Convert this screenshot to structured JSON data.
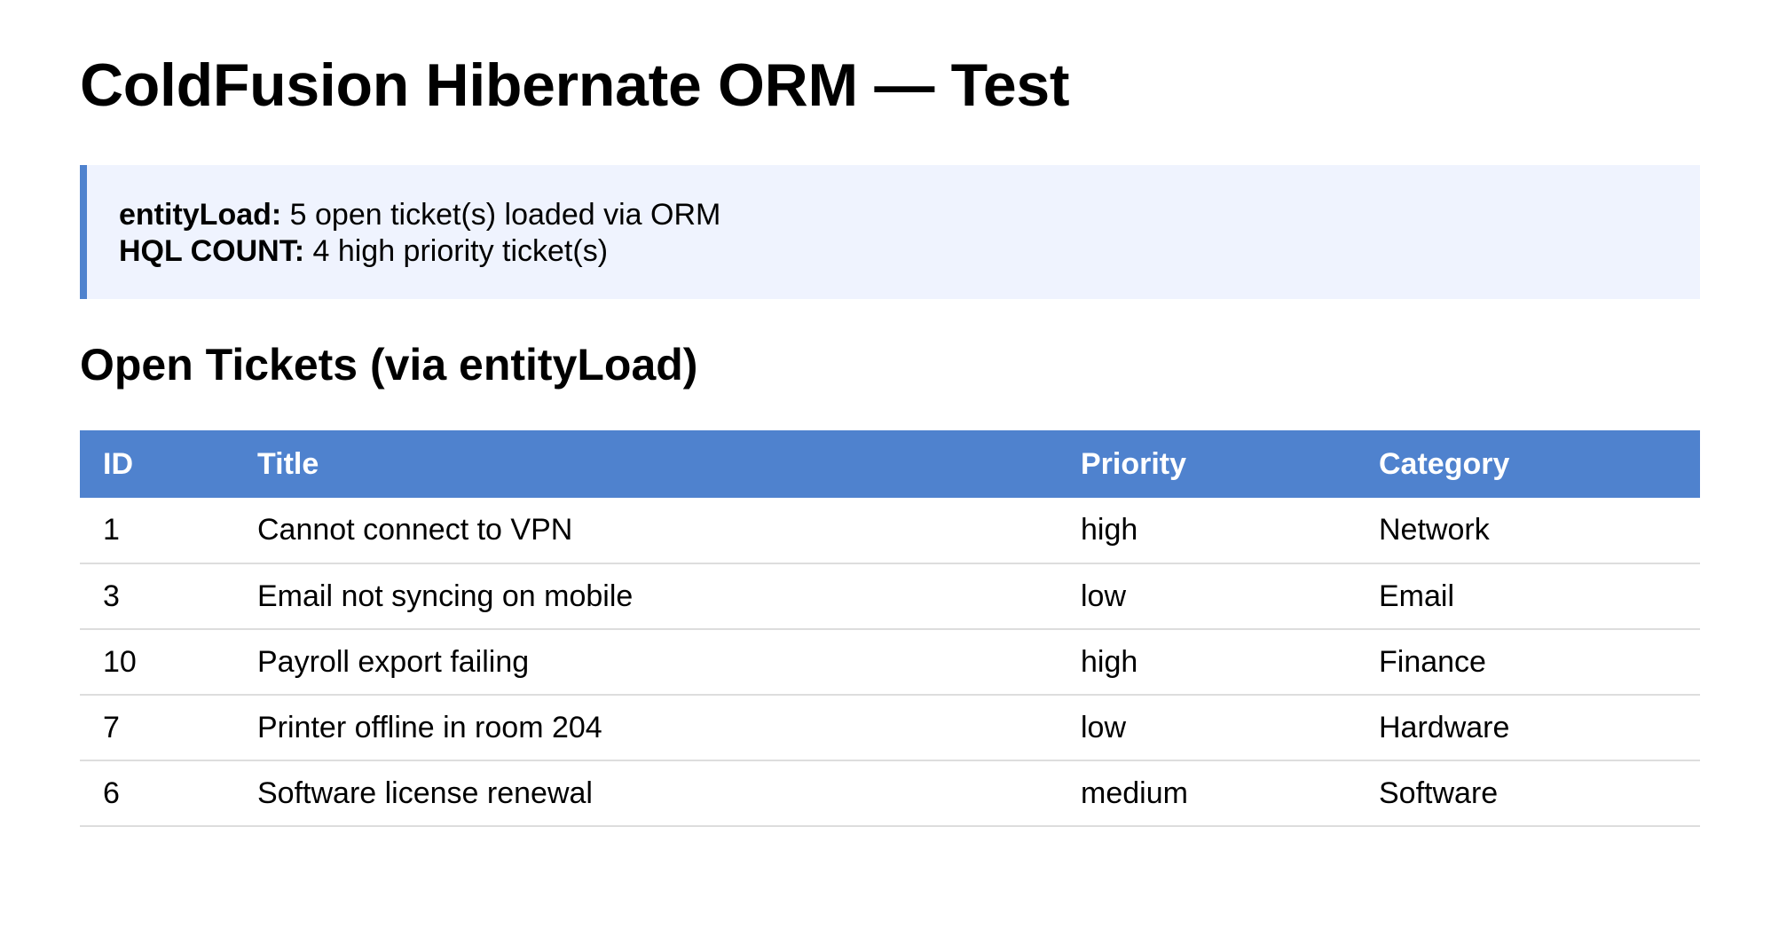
{
  "page": {
    "title": "ColdFusion Hibernate ORM — Test"
  },
  "info": {
    "entity_load_label": "entityLoad:",
    "entity_load_text": " 5 open ticket(s) loaded via ORM",
    "hql_count_label": "HQL COUNT:",
    "hql_count_text": " 4 high priority ticket(s)"
  },
  "section": {
    "title": "Open Tickets (via entityLoad)"
  },
  "table": {
    "headers": [
      "ID",
      "Title",
      "Priority",
      "Category"
    ],
    "rows": [
      {
        "id": "1",
        "title": "Cannot connect to VPN",
        "priority": "high",
        "category": "Network"
      },
      {
        "id": "3",
        "title": "Email not syncing on mobile",
        "priority": "low",
        "category": "Email"
      },
      {
        "id": "10",
        "title": "Payroll export failing",
        "priority": "high",
        "category": "Finance"
      },
      {
        "id": "7",
        "title": "Printer offline in room 204",
        "priority": "low",
        "category": "Hardware"
      },
      {
        "id": "6",
        "title": "Software license renewal",
        "priority": "medium",
        "category": "Software"
      }
    ]
  },
  "colors": {
    "accent": "#4f82ce",
    "info_background": "#eff3fe",
    "row_divider": "#dddddd"
  }
}
